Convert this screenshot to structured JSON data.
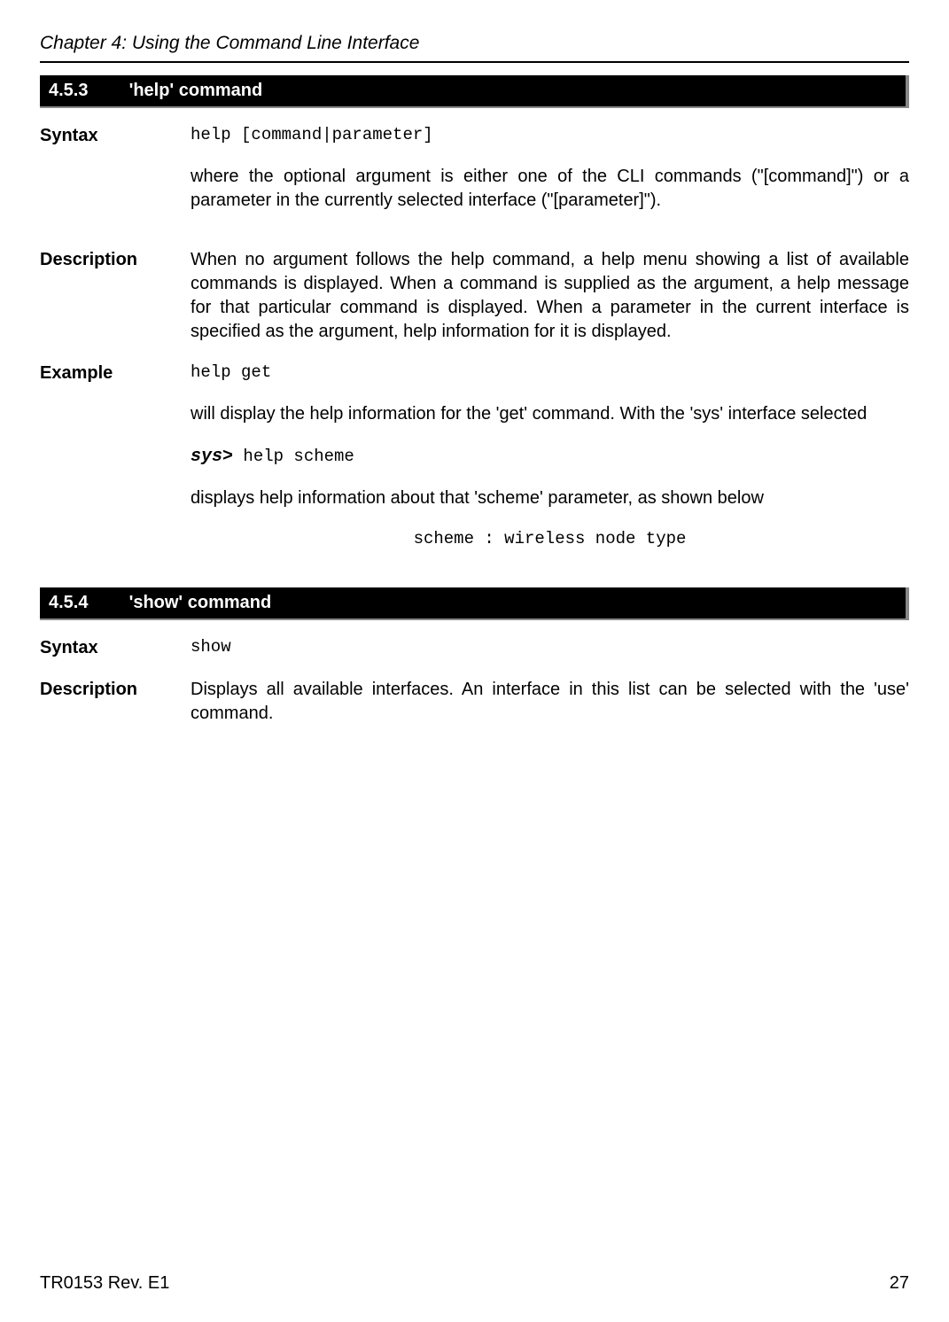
{
  "header": {
    "chapter": "Chapter 4: Using the Command Line Interface"
  },
  "section1": {
    "number": "4.5.3",
    "title": "'help' command",
    "syntax_label": "Syntax",
    "syntax_code": "help [command|parameter]",
    "syntax_text": "where the optional argument is either one of the CLI commands (\"[command]\") or a parameter in the currently selected interface (\"[parameter]\").",
    "description_label": "Description",
    "description_text": "When no argument follows the help command, a help menu showing a list of available commands is displayed. When a command is supplied as the argument, a help message for that particular command is displayed. When a parameter in the current interface is specified as the argument, help information for it is displayed.",
    "example_label": "Example",
    "example_code": "help get",
    "example_text1": "will display the help information for the 'get' command. With the 'sys' interface selected",
    "example_prompt": "sys>",
    "example_prompt_cmd": " help scheme",
    "example_text2": "displays help information about that 'scheme' parameter, as shown below",
    "example_output": "scheme : wireless node type"
  },
  "section2": {
    "number": "4.5.4",
    "title": "'show' command",
    "syntax_label": "Syntax",
    "syntax_code": "show",
    "description_label": "Description",
    "description_text": "Displays all available interfaces. An interface in this list can be selected with the 'use' command."
  },
  "footer": {
    "doc_id": "TR0153 Rev. E1",
    "page": "27"
  }
}
